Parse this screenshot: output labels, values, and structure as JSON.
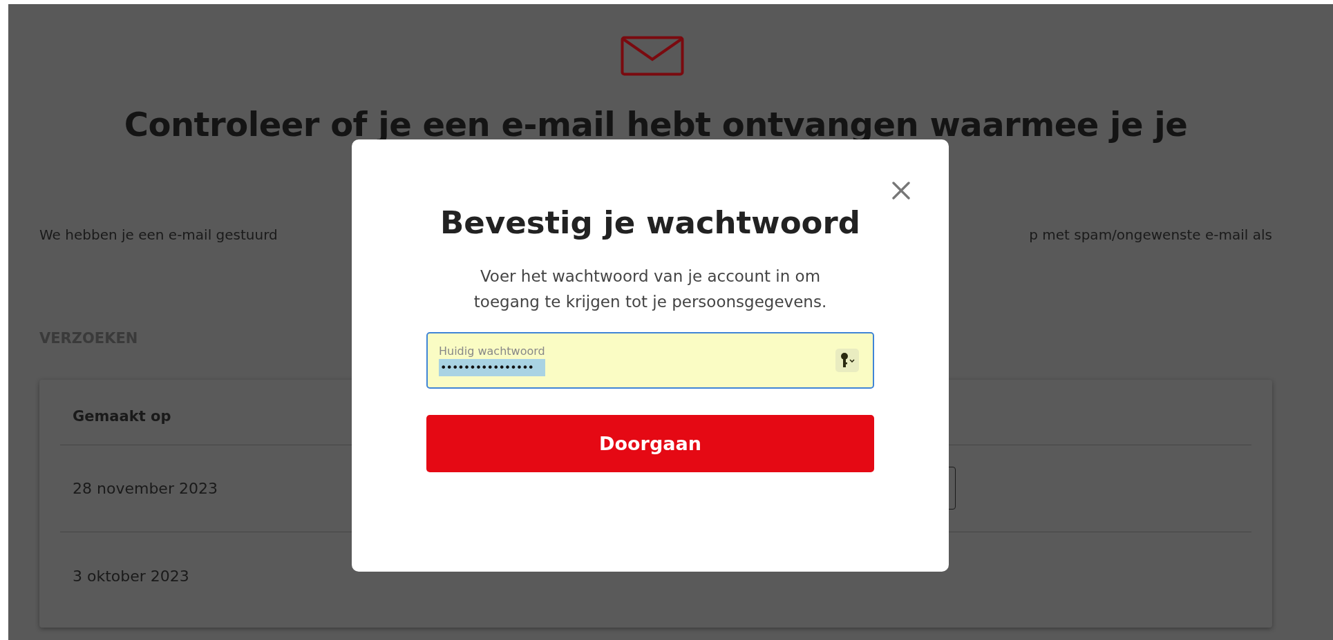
{
  "page": {
    "heading": "Controleer of je een e-mail hebt ontvangen waarmee je je",
    "intro_left": "We hebben je een e-mail gestuurd",
    "intro_right": "p met spam/ongewenste e-mail als",
    "section_title": "VERZOEKEN",
    "table": {
      "columns": [
        "Gemaakt op"
      ],
      "rows": [
        {
          "date": "28 november 2023",
          "has_button": true
        },
        {
          "date": "3 oktober 2023",
          "has_button": false
        }
      ]
    }
  },
  "dialog": {
    "title": "Bevestig je wachtwoord",
    "message": "Voer het wachtwoord van je account in om toegang te krijgen tot je persoonsgegevens.",
    "field": {
      "label": "Huidig wachtwoord",
      "value": "••••••••••••••••",
      "focused": true,
      "autofilled": true
    },
    "button": "Doorgaan"
  }
}
